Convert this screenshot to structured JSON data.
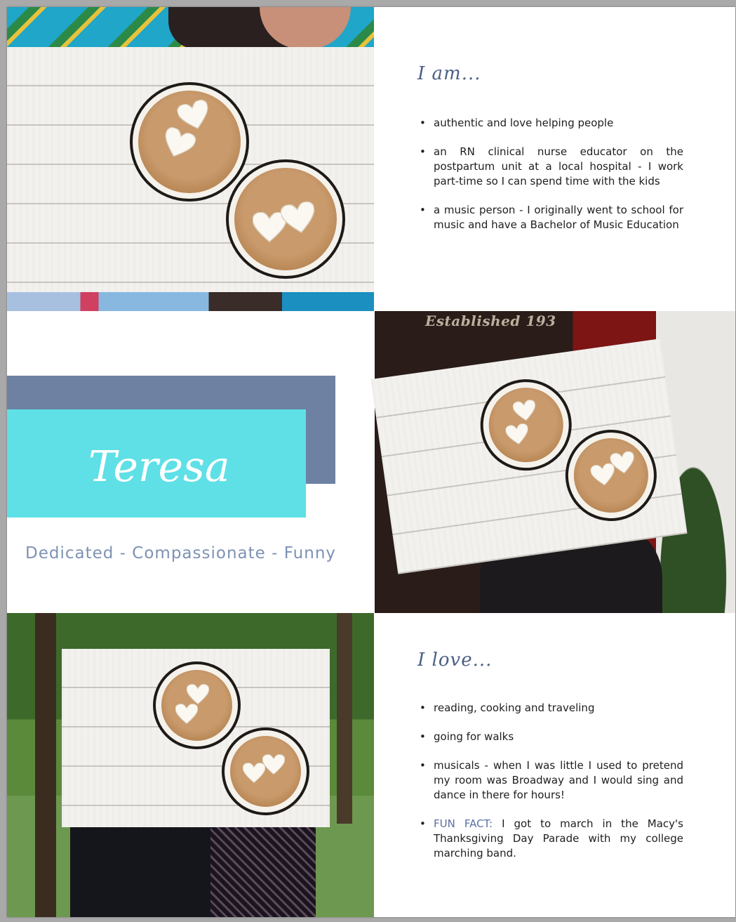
{
  "about": {
    "heading": "I am...",
    "items": [
      "authentic and love helping people",
      "an RN clinical nurse educator on the postpartum unit at a local hospital - I work part-time so I can spend time with the kids",
      "a music person - I originally went to school for music and have a Bachelor of Music Education"
    ]
  },
  "profile": {
    "name": "Teresa",
    "tagline": "Dedicated - Compassionate - Funny"
  },
  "photo_sign": "Established 193",
  "loves": {
    "heading": "I love...",
    "items": [
      "reading, cooking and traveling",
      "going for walks",
      "musicals - when I was little I used to pretend my room was Broadway and I would sing and dance in there for hours!"
    ],
    "fun_fact_label": "FUN FACT:",
    "fun_fact_text": " I got to march in the Macy's Thanksgiving Day Parade with my college marching band."
  },
  "colors": {
    "slate": "#6e81a3",
    "teal": "#5ee0e6",
    "heading": "#4b5f86",
    "tagline": "#7e92b4"
  }
}
